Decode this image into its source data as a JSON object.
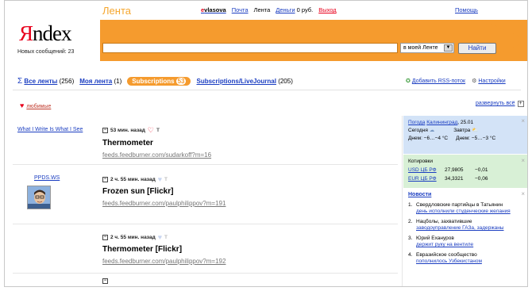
{
  "header": {
    "logo_y": "Я",
    "logo_rest": "ndex",
    "new_messages": "Новых сообщений: 23",
    "section_title": "Лента",
    "help": "Помощь"
  },
  "topnav": {
    "user": "vlasova",
    "user_initial": "e",
    "mail": "Почта",
    "lenta": "Лента",
    "money": "Деньги",
    "money_value": "0 руб.",
    "exit": "Выход"
  },
  "search": {
    "query": "",
    "scope": "в моей Ленте",
    "button": "Найти"
  },
  "tabs": [
    {
      "label": "Все ленты",
      "count": "(256)"
    },
    {
      "label": "Моя лента",
      "count": "(1)"
    },
    {
      "label": "Subscriptions",
      "count": "53"
    },
    {
      "label": "Subscriptions/LiveJournal",
      "count": "(205)"
    }
  ],
  "tools": {
    "add_rss": "Добавить RSS-поток",
    "settings": "Настройки"
  },
  "favorites": "любимые",
  "expand_all": "развернуть всё",
  "expand_box": "+",
  "feed": [
    {
      "source": "What I Write Is What I See",
      "time": "53 мин. назад",
      "tag": "T",
      "title": "Thermometer",
      "url": "feeds.feedburner.com/sudarkoff?m=16"
    },
    {
      "source": "PPDS.WS",
      "time": "2 ч. 55 мин. назад",
      "tag": "T",
      "title": "Frozen sun [Flickr]",
      "url": "feeds.feedburner.com/paulphilippov?m=191"
    },
    {
      "source": "",
      "time": "2 ч. 55 мин. назад",
      "tag": "T",
      "title": "Thermometer [Flickr]",
      "url": "feeds.feedburner.com/paulphilippov?m=192"
    }
  ],
  "weather": {
    "label": "Погода",
    "city": "Калининград",
    "date": "25.01",
    "today": "Сегодня",
    "tomorrow": "Завтра",
    "today_temp": "Днем: −6…−4 °C",
    "tomorrow_temp": "Днем: −5…−3 °C"
  },
  "quotes": {
    "title": "Котировки",
    "rows": [
      {
        "name": "USD ЦБ РФ",
        "value": "27,9805",
        "change": "−0,01"
      },
      {
        "name": "EUR ЦБ РФ",
        "value": "34,3321",
        "change": "−0,06"
      }
    ]
  },
  "news": {
    "title": "Новости",
    "items": [
      {
        "num": "1.",
        "text": "Свердловские партийцы в Татьянин",
        "link": "день исполнили студенческие желания"
      },
      {
        "num": "2.",
        "text": "Нацболы, захватившие",
        "link": "заводоуправление ГАЗа, задержаны"
      },
      {
        "num": "3.",
        "text": "Юрий Ехануров",
        "link": "держит руку на вентиле"
      },
      {
        "num": "4.",
        "text": "Евразийское сообщество",
        "link": "пополнилось Узбекистаном"
      }
    ]
  },
  "colors": {
    "brand_orange": "#f59b2e",
    "link_blue": "#1a3dc1",
    "weather_bg": "#d3e3f7",
    "quotes_bg": "#d8f0d6"
  }
}
